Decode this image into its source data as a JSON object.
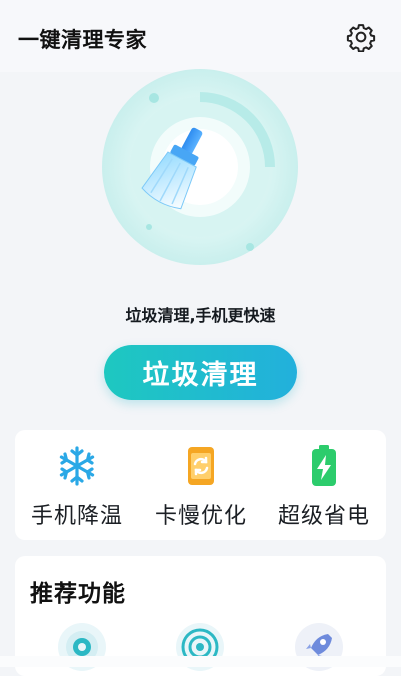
{
  "header": {
    "title": "一键清理专家"
  },
  "hero": {
    "tagline": "垃圾清理,手机更快速"
  },
  "main_button": {
    "label": "垃圾清理"
  },
  "tools": [
    {
      "label": "手机降温",
      "icon": "snowflake-icon"
    },
    {
      "label": "卡慢优化",
      "icon": "phone-refresh-icon"
    },
    {
      "label": "超级省电",
      "icon": "battery-charge-icon"
    }
  ],
  "recommended": {
    "title": "推荐功能"
  },
  "colors": {
    "accent": "#1ec8c0",
    "accent2": "#22b0dc",
    "hero_ring": "#c8f0ee",
    "battery": "#2ccc6c",
    "orange": "#f5a623",
    "ice": "#2aa8e6"
  }
}
